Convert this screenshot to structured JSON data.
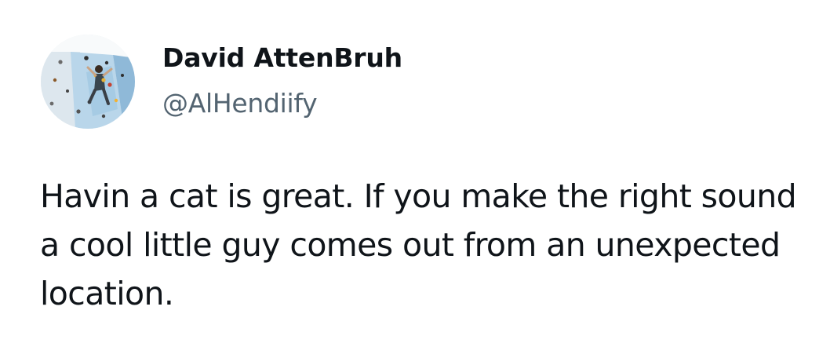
{
  "author": {
    "display_name": "David AttenBruh",
    "handle": "@AlHendiify",
    "avatar_icon": "climbing-wall-photo"
  },
  "tweet": {
    "text": "Havin a cat is great. If you make the right sound a cool little guy comes out from an unexpected location."
  },
  "colors": {
    "text": "#0f1419",
    "handle": "#536471",
    "background": "#ffffff"
  }
}
